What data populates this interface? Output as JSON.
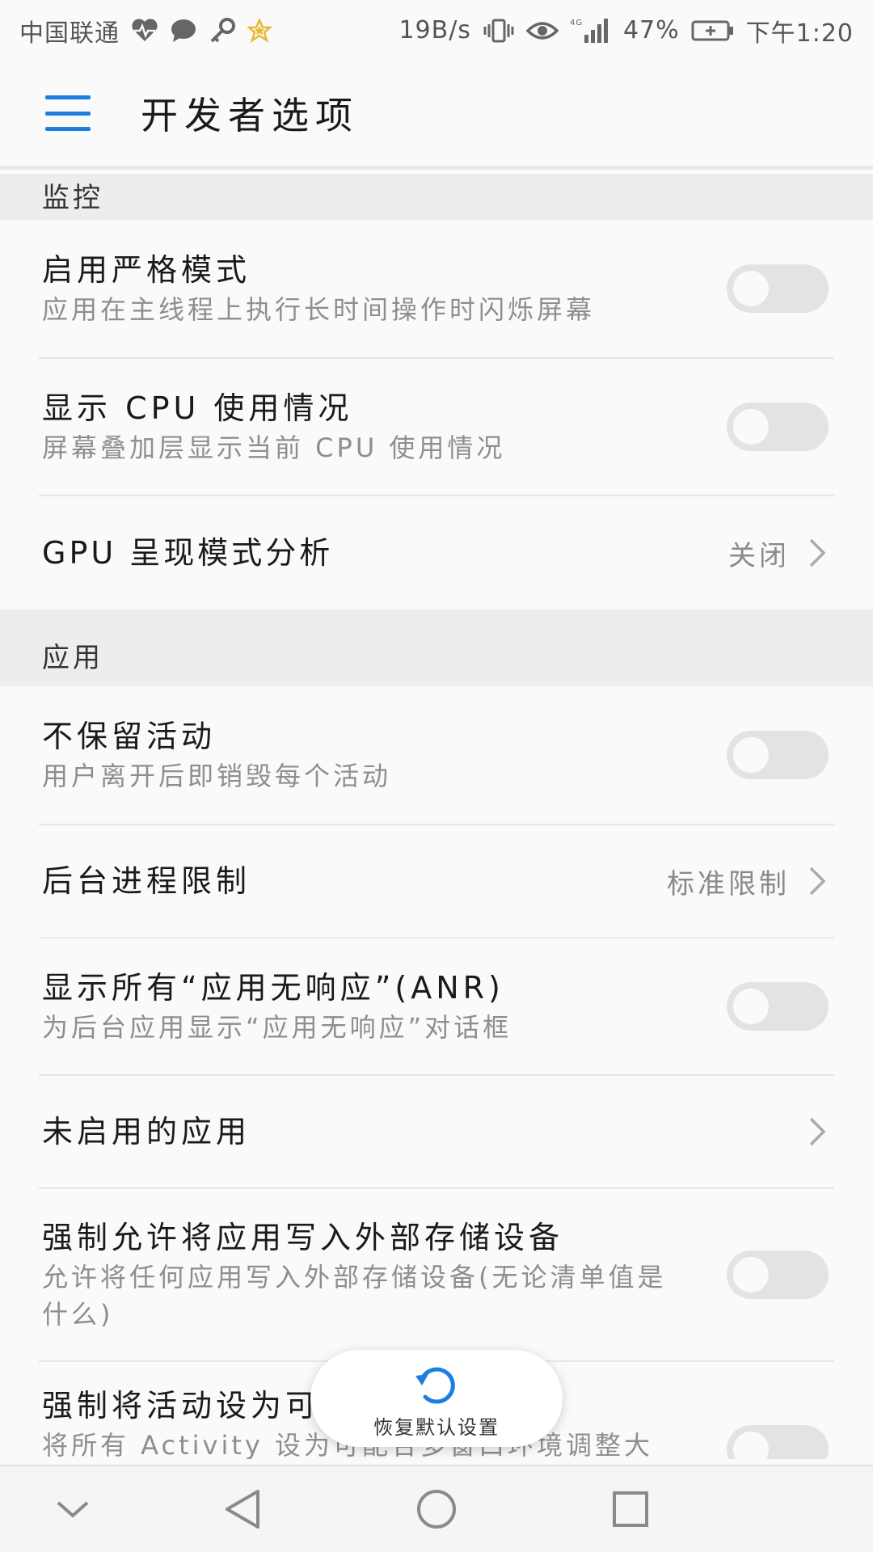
{
  "status_bar": {
    "carrier": "中国联通",
    "net_speed": "19B/s",
    "network_type": "4G",
    "battery_percent": "47%",
    "time": "下午1:20",
    "icons": [
      "heartbeat-icon",
      "chat-bubble-icon",
      "key-icon",
      "star-badge-icon",
      "vibrate-icon",
      "eye-icon",
      "signal-icon",
      "battery-charging-icon"
    ]
  },
  "header": {
    "title": "开发者选项"
  },
  "sections": {
    "monitoring": {
      "label": "监控"
    },
    "apps": {
      "label": "应用"
    }
  },
  "settings": {
    "strict_mode": {
      "title": "启用严格模式",
      "summary": "应用在主线程上执行长时间操作时闪烁屏幕",
      "enabled": false
    },
    "show_cpu": {
      "title": "显示 CPU 使用情况",
      "summary": "屏幕叠加层显示当前 CPU 使用情况",
      "enabled": false
    },
    "gpu_profile": {
      "title": "GPU 呈现模式分析",
      "value": "关闭"
    },
    "dont_keep_activities": {
      "title": "不保留活动",
      "summary": "用户离开后即销毁每个活动",
      "enabled": false
    },
    "background_limit": {
      "title": "后台进程限制",
      "value": "标准限制"
    },
    "show_anr": {
      "title": "显示所有“应用无响应”(ANR)",
      "summary": "为后台应用显示“应用无响应”对话框",
      "enabled": false
    },
    "inactive_apps": {
      "title": "未启用的应用"
    },
    "force_external": {
      "title": "强制允许将应用写入外部存储设备",
      "summary": "允许将任何应用写入外部存储设备(无论清单值是什么)",
      "enabled": false
    },
    "force_resizable": {
      "title": "强制将活动设为可调整大小",
      "summary": "将所有 Activity 设为可配合多窗口环境调整大",
      "enabled": false
    }
  },
  "restore_button": {
    "label": "恢复默认设置"
  },
  "colors": {
    "accent": "#1e7ee0",
    "toggle_off": "#e3e3e3",
    "section_bg": "#ededed"
  }
}
